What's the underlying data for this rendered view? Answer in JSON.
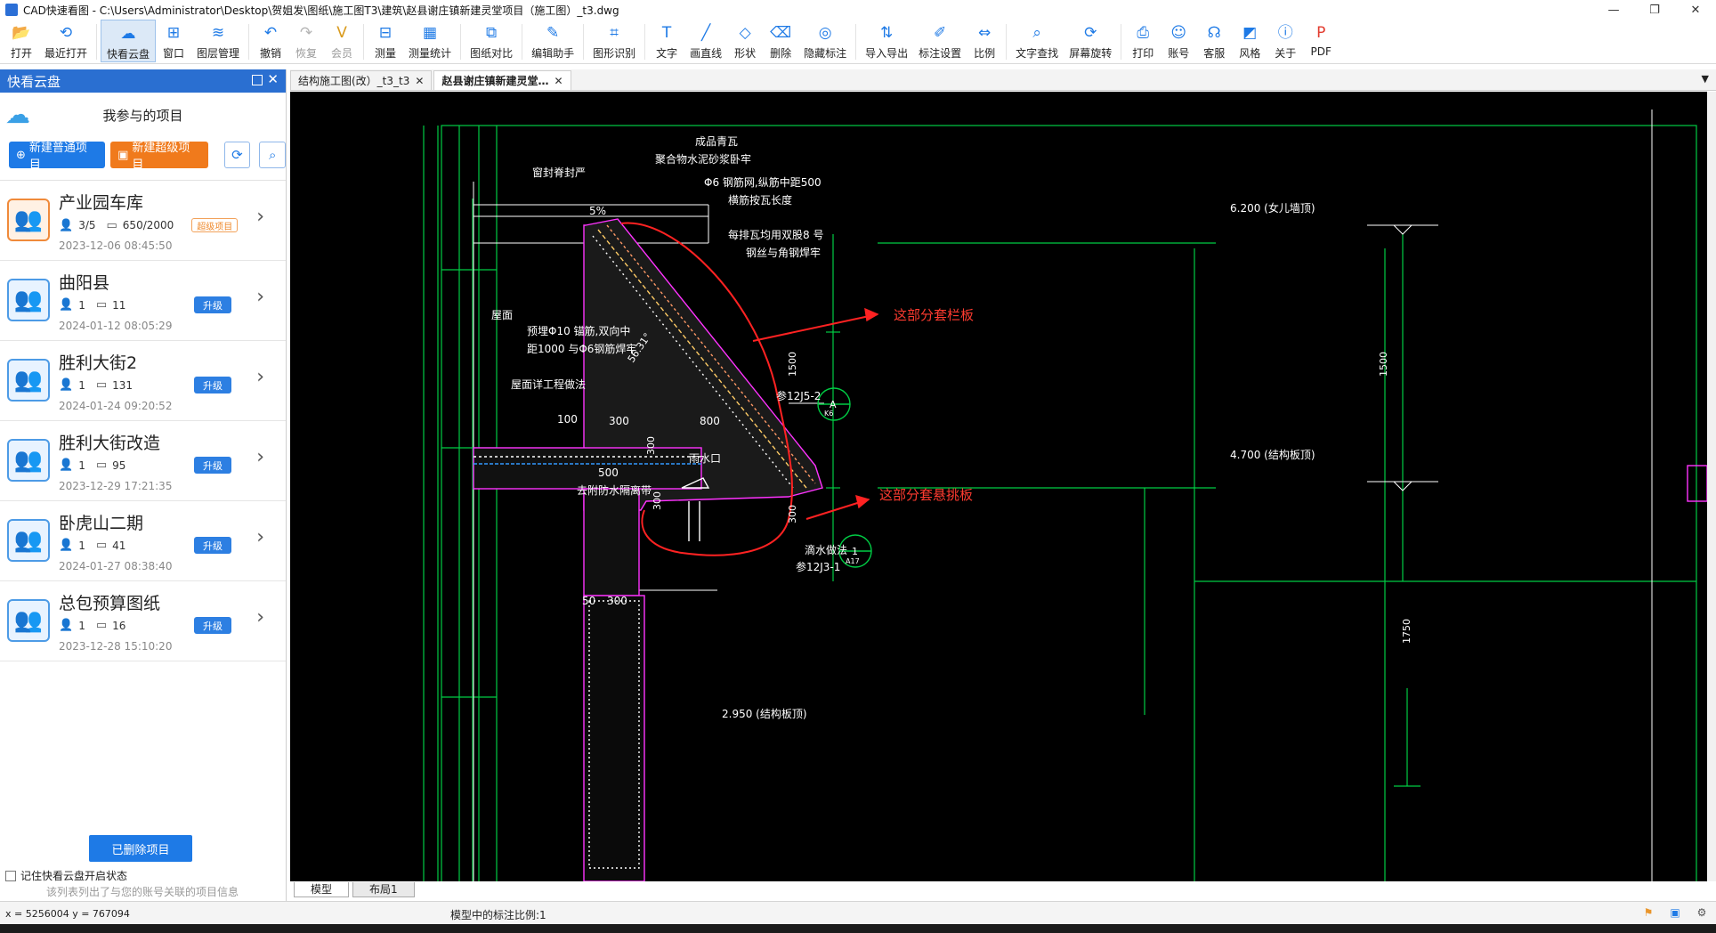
{
  "window": {
    "title": "CAD快速看图 - C:\\Users\\Administrator\\Desktop\\贺姐发\\图纸\\施工图T3\\建筑\\赵县谢庄镇新建灵堂项目（施工图）_t3.dwg",
    "minimize": "—",
    "maximize": "❐",
    "close": "✕"
  },
  "toolbar": [
    {
      "label": "打开",
      "icon": "folder-icon",
      "glyph": "📂",
      "color": "#1e7ae6"
    },
    {
      "label": "最近打开",
      "icon": "history-icon",
      "glyph": "⟲",
      "color": "#1e7ae6"
    },
    {
      "label": "快看云盘",
      "icon": "cloud-icon",
      "glyph": "☁",
      "color": "#1e7ae6",
      "active": true
    },
    {
      "label": "窗口",
      "icon": "window-icon",
      "glyph": "⊞",
      "color": "#1e7ae6"
    },
    {
      "label": "图层管理",
      "icon": "layers-icon",
      "glyph": "≋",
      "color": "#1e7ae6"
    },
    {
      "label": "撤销",
      "icon": "undo-icon",
      "glyph": "↶",
      "color": "#1e7ae6"
    },
    {
      "label": "恢复",
      "icon": "redo-icon",
      "glyph": "↷",
      "color": "#b5b5b5",
      "dim": true
    },
    {
      "label": "会员",
      "icon": "vip-icon",
      "glyph": "V",
      "color": "#d99a1c",
      "dim": true
    },
    {
      "label": "测量",
      "icon": "measure-icon",
      "glyph": "⊟",
      "color": "#1e7ae6"
    },
    {
      "label": "测量统计",
      "icon": "measure-stats-icon",
      "glyph": "▦",
      "color": "#1e7ae6"
    },
    {
      "label": "图纸对比",
      "icon": "compare-icon",
      "glyph": "⧉",
      "color": "#1e7ae6"
    },
    {
      "label": "编辑助手",
      "icon": "edit-assistant-icon",
      "glyph": "✎",
      "color": "#1e7ae6"
    },
    {
      "label": "图形识别",
      "icon": "shape-recognition-icon",
      "glyph": "⌗",
      "color": "#1e7ae6"
    },
    {
      "label": "文字",
      "icon": "text-icon",
      "glyph": "T",
      "color": "#1e7ae6"
    },
    {
      "label": "画直线",
      "icon": "line-icon",
      "glyph": "╱",
      "color": "#1e7ae6"
    },
    {
      "label": "形状",
      "icon": "shape-icon",
      "glyph": "◇",
      "color": "#1e7ae6"
    },
    {
      "label": "删除",
      "icon": "eraser-icon",
      "glyph": "⌫",
      "color": "#1e7ae6"
    },
    {
      "label": "隐藏标注",
      "icon": "hide-annotation-icon",
      "glyph": "◎",
      "color": "#1e7ae6"
    },
    {
      "label": "导入导出",
      "icon": "import-export-icon",
      "glyph": "⇅",
      "color": "#1e7ae6"
    },
    {
      "label": "标注设置",
      "icon": "annotation-settings-icon",
      "glyph": "✐",
      "color": "#1e7ae6"
    },
    {
      "label": "比例",
      "icon": "scale-icon",
      "glyph": "⇔",
      "color": "#1e7ae6"
    },
    {
      "label": "文字查找",
      "icon": "text-search-icon",
      "glyph": "⌕",
      "color": "#1e7ae6"
    },
    {
      "label": "屏幕旋转",
      "icon": "rotate-screen-icon",
      "glyph": "⟳",
      "color": "#1e7ae6"
    },
    {
      "label": "打印",
      "icon": "print-icon",
      "glyph": "⎙",
      "color": "#1e7ae6"
    },
    {
      "label": "账号",
      "icon": "account-icon",
      "glyph": "☺",
      "color": "#1e7ae6"
    },
    {
      "label": "客服",
      "icon": "headset-icon",
      "glyph": "☊",
      "color": "#1e7ae6"
    },
    {
      "label": "风格",
      "icon": "style-icon",
      "glyph": "◩",
      "color": "#1e7ae6"
    },
    {
      "label": "关于",
      "icon": "info-icon",
      "glyph": "ⓘ",
      "color": "#1e7ae6"
    },
    {
      "label": "PDF",
      "icon": "pdf-icon",
      "glyph": "P",
      "color": "#e23b2e"
    }
  ],
  "sidebar": {
    "title": "快看云盘",
    "close": "✕",
    "subtitle": "我参与的项目",
    "new_normal": "新建普通项目",
    "new_super": "新建超级项目",
    "deleted_button": "已删除项目",
    "remember_label": "记住快看云盘开启状态",
    "footer_note": "该列表列出了与您的账号关联的项目信息",
    "projects": [
      {
        "name": "产业园车库",
        "members": "3/5",
        "files": "650/2000",
        "tag": "超级项目",
        "date": "2023-12-06 08:45:50",
        "type": "super"
      },
      {
        "name": "曲阳县",
        "members": "1",
        "files": "11",
        "tag": "升级",
        "date": "2024-01-12 08:05:29",
        "type": "normal"
      },
      {
        "name": "胜利大街2",
        "members": "1",
        "files": "131",
        "tag": "升级",
        "date": "2024-01-24 09:20:52",
        "type": "normal"
      },
      {
        "name": "胜利大街改造",
        "members": "1",
        "files": "95",
        "tag": "升级",
        "date": "2023-12-29 17:21:35",
        "type": "normal"
      },
      {
        "name": "卧虎山二期",
        "members": "1",
        "files": "41",
        "tag": "升级",
        "date": "2024-01-27 08:38:40",
        "type": "normal"
      },
      {
        "name": "总包预算图纸",
        "members": "1",
        "files": "16",
        "tag": "升级",
        "date": "2023-12-28 15:10:20",
        "type": "normal"
      }
    ]
  },
  "tabs": [
    {
      "label": "结构施工图(改）_t3_t3",
      "close": "✕",
      "active": false
    },
    {
      "label": "赵县谢庄镇新建灵堂…",
      "close": "✕",
      "active": true
    }
  ],
  "layout_tabs": [
    "模型",
    "布局1"
  ],
  "status": {
    "coords": "x = 5256004  y = 767094",
    "scale": "模型中的标注比例:1"
  },
  "drawing": {
    "labels": {
      "tile": "成品青瓦",
      "mortar": "聚合物水泥砂浆卧牢",
      "ridge": "窗封脊封严",
      "mesh": "Φ6 钢筋网,纵筋中距500",
      "mesh2": "横筋按瓦长度",
      "wire": "每排瓦均用双股8 号",
      "wire2": "钢丝与角钢焊牢",
      "roof": "屋面",
      "embed": "预埋Φ10 锚筋,双向中",
      "embed2": "距1000 与Φ6钢筋焊牢",
      "roof_detail": "屋面详工程做法",
      "gutter": "雨水口",
      "waterproof": "去附防水隔离带",
      "drip": "滴水做法",
      "ref1": "参12J5-2",
      "ref2": "参12J3-1",
      "elev1": "6.200  (女儿墙顶)",
      "elev2": "4.700  (结构板顶)",
      "elev3": "2.950  (结构板顶)",
      "dim1500": "1500",
      "dim1500b": "1500",
      "dim300": "300",
      "dim300b": "300",
      "dim100": "100",
      "dim300c": "300",
      "dim800": "800",
      "dim500": "500",
      "dim300d": "300",
      "dim50": "50",
      "dim300e": "300",
      "dim1750": "1750",
      "slope": "5%",
      "angle": "56.31°",
      "circA": "A",
      "circK6": "K6",
      "circ1": "1",
      "circA17": "A17"
    },
    "notes": [
      {
        "text": "这部分套栏板",
        "color": "#ff3b30"
      },
      {
        "text": "这部分套悬挑板",
        "color": "#ff3b30"
      }
    ]
  }
}
